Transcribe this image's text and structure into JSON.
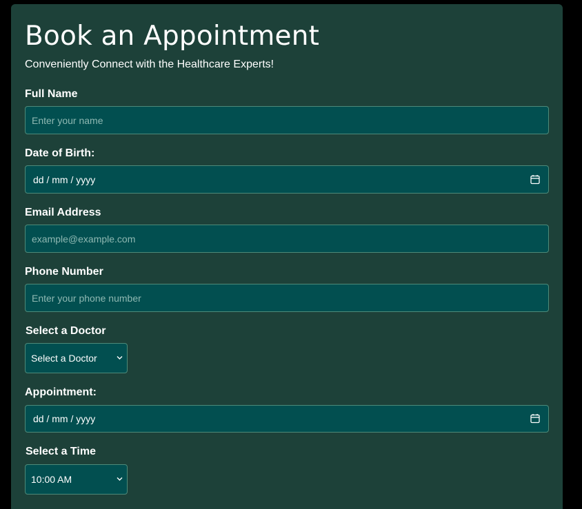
{
  "form": {
    "title": "Book an Appointment",
    "subtitle": "Conveniently Connect with the Healthcare Experts!",
    "full_name": {
      "label": "Full Name",
      "placeholder": "Enter your name"
    },
    "dob": {
      "label": "Date of Birth:",
      "value": "dd / mm / yyyy"
    },
    "email": {
      "label": "Email Address",
      "placeholder": "example@example.com"
    },
    "phone": {
      "label": "Phone Number",
      "placeholder": "Enter your phone number"
    },
    "doctor": {
      "label": "Select a Doctor",
      "selected": "Select a Doctor"
    },
    "appointment": {
      "label": "Appointment:",
      "value": "dd / mm / yyyy"
    },
    "time": {
      "label": "Select a Time",
      "selected": "10:00 AM"
    }
  },
  "colors": {
    "page_background": "#000000",
    "card_background": "#1d4139",
    "input_background": "#024f50",
    "input_border": "#4e8a79",
    "placeholder_text": "#8fb8b2",
    "text": "#ffffff"
  },
  "icons": {
    "date_picker": "calendar-icon",
    "select_arrow": "chevron-down-icon"
  }
}
